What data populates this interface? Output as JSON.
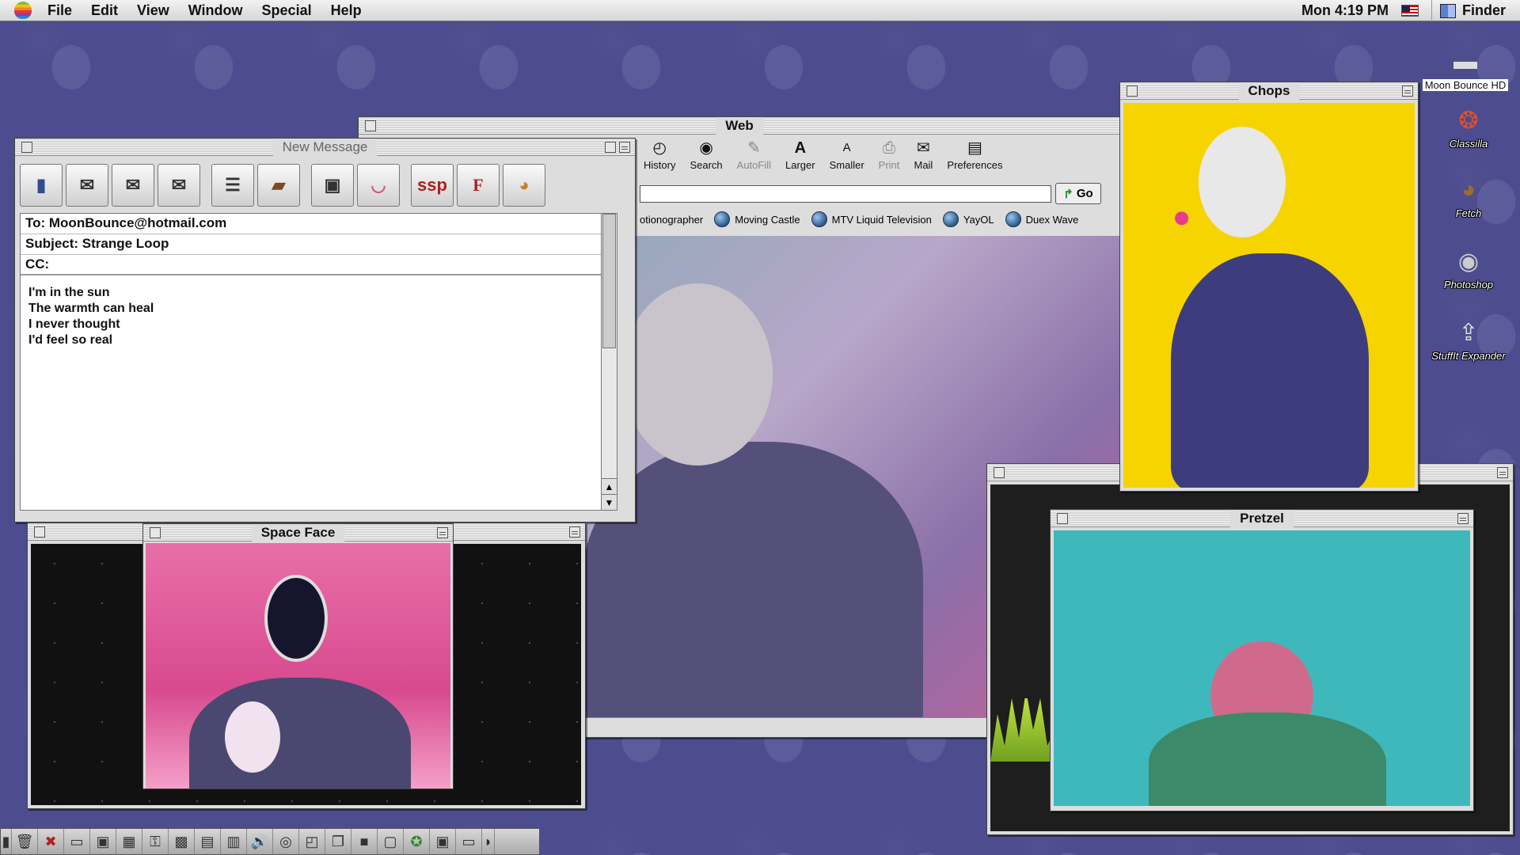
{
  "menubar": {
    "items": [
      "File",
      "Edit",
      "View",
      "Window",
      "Special",
      "Help"
    ],
    "clock": "Mon 4:19 PM",
    "active_app": "Finder"
  },
  "web": {
    "title": "Web",
    "toolbar": [
      {
        "label": "History",
        "icon": "history-icon",
        "enabled": true
      },
      {
        "label": "Search",
        "icon": "search-icon",
        "enabled": true
      },
      {
        "label": "AutoFill",
        "icon": "autofill-icon",
        "enabled": false
      },
      {
        "label": "Larger",
        "icon": "larger-icon",
        "enabled": true
      },
      {
        "label": "Smaller",
        "icon": "smaller-icon",
        "enabled": true
      },
      {
        "label": "Print",
        "icon": "print-icon",
        "enabled": false
      },
      {
        "label": "Mail",
        "icon": "mail-icon",
        "enabled": true
      },
      {
        "label": "Preferences",
        "icon": "preferences-icon",
        "enabled": true
      }
    ],
    "address_value": "",
    "go_label": "Go",
    "favorites": [
      "otionographer",
      "Moving Castle",
      "MTV Liquid Television",
      "YayOL",
      "Duex Wave"
    ]
  },
  "message": {
    "title": "New Message",
    "to": "To: MoonBounce@hotmail.com",
    "subject": "Subject: Strange Loop",
    "cc": "CC:",
    "body_lines": [
      "I'm in the sun",
      "The warmth can heal",
      "I never thought",
      "I'd feel so real"
    ],
    "tools": [
      "mailbox-icon",
      "envelope-icon",
      "reply-icon",
      "forward-icon",
      "document-icon",
      "book-icon",
      "address-card-icon",
      "lips-icon",
      "ssp-icon",
      "font-icon",
      "palette-icon"
    ],
    "ssp_label": "ssp",
    "font_label": "F"
  },
  "space_face": {
    "title": "Space Face"
  },
  "chops": {
    "title": "Chops"
  },
  "pretzel": {
    "title": "Pretzel"
  },
  "desktop_icons": [
    {
      "label": "Moon Bounce HD",
      "icon": "hard-drive-icon"
    },
    {
      "label": "Classilla",
      "icon": "classilla-icon"
    },
    {
      "label": "Fetch",
      "icon": "fetch-dog-icon"
    },
    {
      "label": "Photoshop",
      "icon": "photoshop-eye-icon"
    },
    {
      "label": "StuffIt Expander",
      "icon": "stuffit-icon"
    }
  ]
}
